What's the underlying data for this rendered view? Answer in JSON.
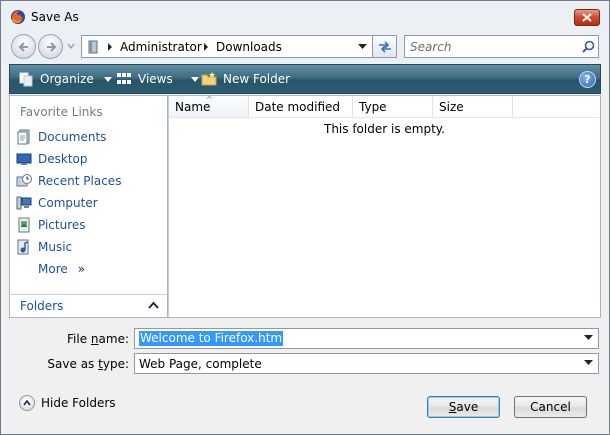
{
  "window": {
    "title": "Save As"
  },
  "address": {
    "crumbs": [
      "Administrator",
      "Downloads"
    ]
  },
  "search": {
    "placeholder": "Search"
  },
  "commandbar": {
    "organize": "Organize",
    "views": "Views",
    "new_folder": "New Folder",
    "help": "?"
  },
  "navigation": {
    "favorite_links_title": "Favorite Links",
    "items": [
      {
        "label": "Documents",
        "icon": "documents-icon"
      },
      {
        "label": "Desktop",
        "icon": "desktop-icon"
      },
      {
        "label": "Recent Places",
        "icon": "recent-places-icon"
      },
      {
        "label": "Computer",
        "icon": "computer-icon"
      },
      {
        "label": "Pictures",
        "icon": "pictures-icon"
      },
      {
        "label": "Music",
        "icon": "music-icon"
      }
    ],
    "more": "More",
    "folders": "Folders"
  },
  "filelist": {
    "columns": [
      "Name",
      "Date modified",
      "Type",
      "Size"
    ],
    "empty_message": "This folder is empty."
  },
  "form": {
    "file_name_label_pre": "File ",
    "file_name_label_key": "n",
    "file_name_label_post": "ame:",
    "file_name_value": "Welcome to Firefox.htm",
    "save_type_label_pre": "Save as ",
    "save_type_label_key": "t",
    "save_type_label_post": "ype:",
    "save_type_value": "Web Page, complete"
  },
  "footer": {
    "hide_folders": "Hide Folders",
    "save_pre": "",
    "save_key": "S",
    "save_post": "ave",
    "cancel": "Cancel"
  },
  "colors": {
    "command_bar": "#3e6c83",
    "link_text": "#1c4f9e",
    "selection": "#3399ff",
    "close_button": "#cf4a2c"
  }
}
